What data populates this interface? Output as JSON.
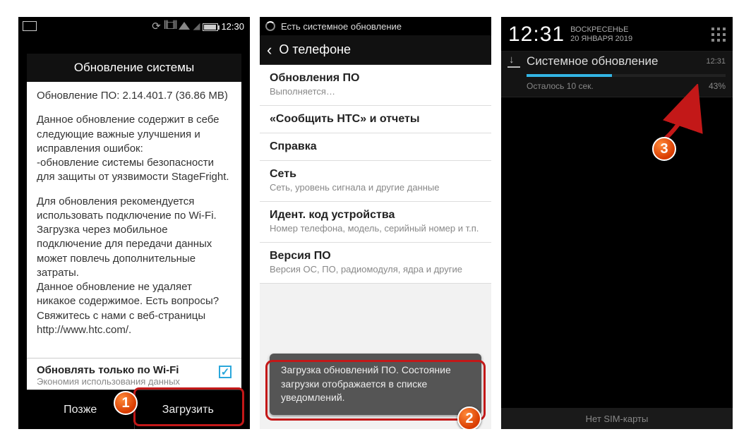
{
  "phone1": {
    "status_time": "12:30",
    "dialog_title": "Обновление системы",
    "version_line": "Обновление ПО: 2.14.401.7 (36.86 MB)",
    "para1": "Данное обновление содержит в себе следующие важные улучшения и исправления ошибок:\n  -обновление системы безопасности для защиты от уязвимости StageFright.",
    "para2": "Для обновления рекомендуется использовать подключение по Wi-Fi. Загрузка через мобильное подключение для передачи данных может повлечь дополнительные затраты.\nДанное обновление не удаляет никакое содержимое. Есть вопросы? Свяжитесь с нами с веб-страницы http://www.htc.com/.",
    "wifi_only_title": "Обновлять только по Wi-Fi",
    "wifi_only_sub": "Экономия использования данных",
    "btn_later": "Позже",
    "btn_download": "Загрузить",
    "badge": "1"
  },
  "phone2": {
    "status_text": "Есть системное обновление",
    "header_title": "О телефоне",
    "items": [
      {
        "t": "Обновления ПО",
        "s": "Выполняется…"
      },
      {
        "t": "«Сообщить HTC» и отчеты",
        "s": ""
      },
      {
        "t": "Справка",
        "s": ""
      },
      {
        "t": "Сеть",
        "s": "Сеть, уровень сигнала и другие данные"
      },
      {
        "t": "Идент. код устройства",
        "s": "Номер телефона, модель, серийный номер и т.п."
      },
      {
        "t": "Версия ПО",
        "s": "Версия ОС, ПО, радиомодуля, ядра и другие"
      }
    ],
    "toast": "Загрузка обновлений ПО. Состояние загрузки отображается в списке уведомлений.",
    "badge": "2"
  },
  "phone3": {
    "clock": "12:31",
    "day": "ВОСКРЕСЕНЬЕ",
    "date": "20 ЯНВАРЯ 2019",
    "notif_title": "Системное обновление",
    "notif_time": "12:31",
    "progress_pct": 43,
    "remaining": "Осталось 10 сек.",
    "pct_label": "43%",
    "bottom_text": "Нет SIM-карты",
    "badge": "3"
  }
}
